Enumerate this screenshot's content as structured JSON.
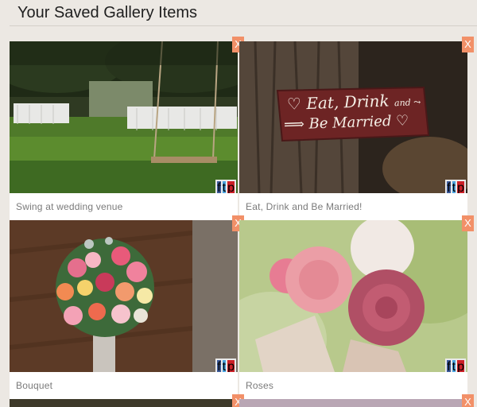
{
  "page": {
    "title": "Your Saved Gallery Items"
  },
  "cards": [
    {
      "caption": "Swing at wedding venue",
      "close_label": "X",
      "sign_line1": "",
      "sign_line2": ""
    },
    {
      "caption": "Eat, Drink and Be Married!",
      "close_label": "X",
      "sign_line1": "♡ Eat, Drink",
      "sign_line1b": "and ⤳",
      "sign_line2": "⟹ Be Married ♡"
    },
    {
      "caption": "Bouquet",
      "close_label": "X"
    },
    {
      "caption": "Roses",
      "close_label": "X"
    },
    {
      "close_label": "X"
    },
    {
      "close_label": "X"
    }
  ],
  "share": {
    "facebook": "f",
    "twitter": "t",
    "pinterest": "p"
  },
  "colors": {
    "close_button": "#f29068",
    "facebook": "#3b5998",
    "twitter": "#4aa3df",
    "pinterest": "#cb2027"
  }
}
